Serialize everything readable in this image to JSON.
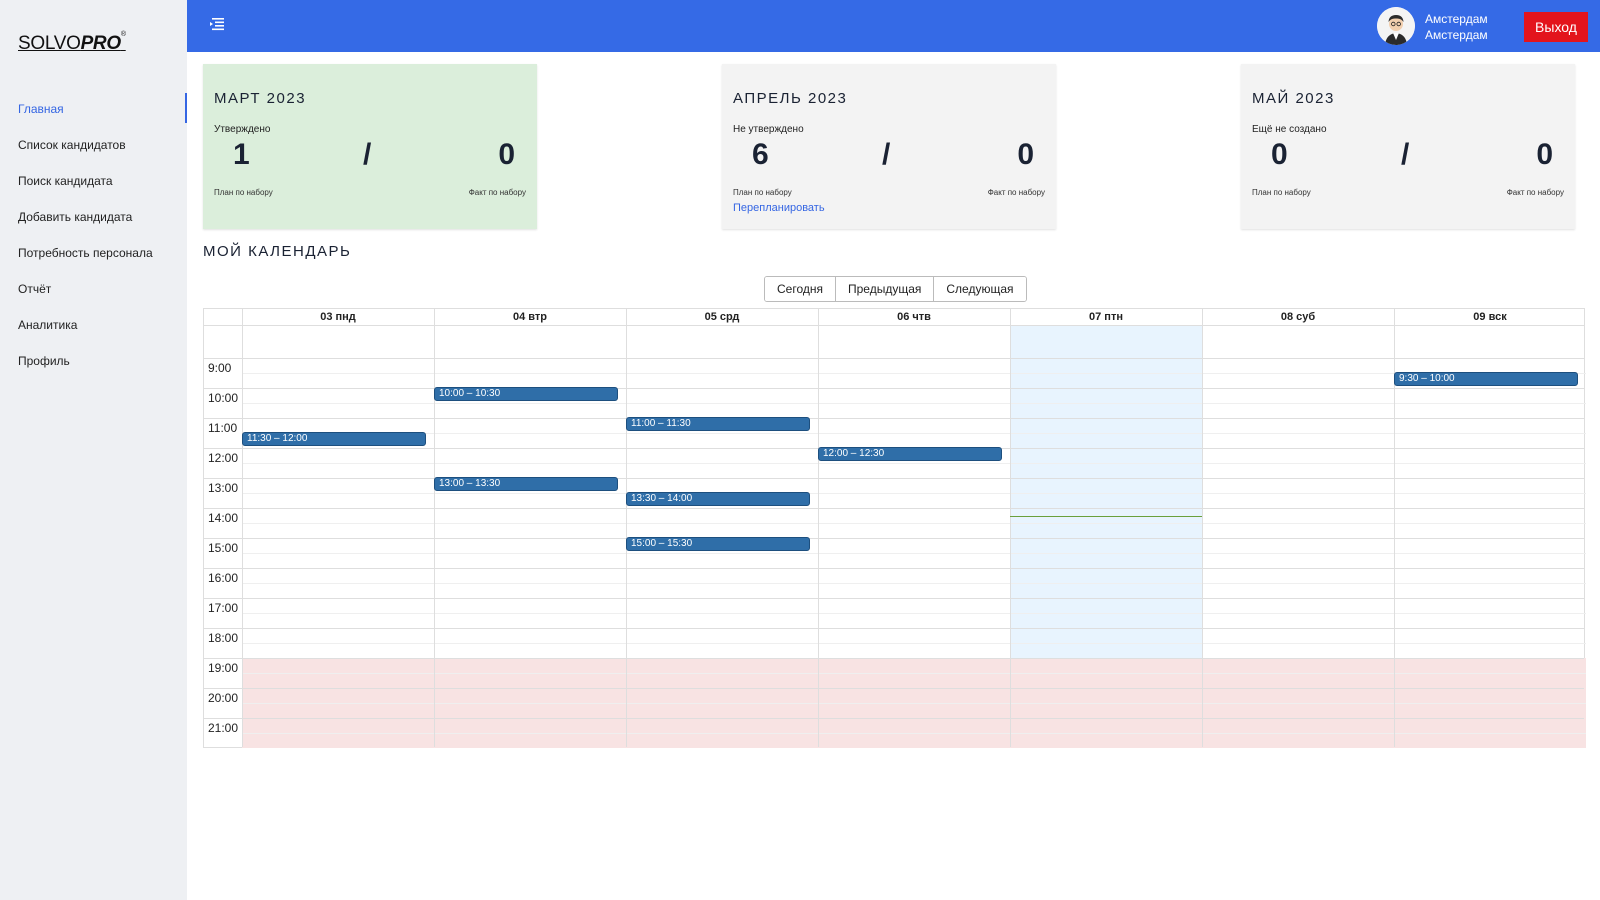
{
  "brand": {
    "name_part1": "SOLVO",
    "name_part2": "PRO",
    "mark": "®"
  },
  "sidebar": {
    "items": [
      {
        "label": "Главная",
        "active": true
      },
      {
        "label": "Список кандидатов"
      },
      {
        "label": "Поиск кандидата"
      },
      {
        "label": "Добавить кандидата"
      },
      {
        "label": "Потребность персонала"
      },
      {
        "label": "Отчёт"
      },
      {
        "label": "Аналитика"
      },
      {
        "label": "Профиль"
      }
    ]
  },
  "header": {
    "user_line1": "Амстердам",
    "user_line2": "Амстердам",
    "logout_label": "Выход",
    "accent": "#356ae6",
    "logout_color": "#e3141c"
  },
  "cards": [
    {
      "title": "МАРТ 2023",
      "status": "Утверждено",
      "plan": "1",
      "slash": "/",
      "fact": "0",
      "plan_label": "План по набору",
      "fact_label": "Факт по набору",
      "link": "",
      "color": "#dbeedb"
    },
    {
      "title": "АПРЕЛЬ 2023",
      "status": "Не утверждено",
      "plan": "6",
      "slash": "/",
      "fact": "0",
      "plan_label": "План по набору",
      "fact_label": "Факт по набору",
      "link": "Перепланировать",
      "color": "#f3f3f3"
    },
    {
      "title": "МАЙ 2023",
      "status": "Ещё не создано",
      "plan": "0",
      "slash": "/",
      "fact": "0",
      "plan_label": "План по набору",
      "fact_label": "Факт по набору",
      "link": "",
      "color": "#f3f3f3"
    }
  ],
  "calendar": {
    "title": "МОЙ КАЛЕНДАРЬ",
    "buttons": {
      "today": "Сегодня",
      "prev": "Предыдущая",
      "next": "Следующая"
    },
    "days": [
      "03 пнд",
      "04 втр",
      "05 срд",
      "06 чтв",
      "07 птн",
      "08 суб",
      "09 вск"
    ],
    "today_index": 4,
    "hours": [
      "9:00",
      "10:00",
      "11:00",
      "12:00",
      "13:00",
      "14:00",
      "15:00",
      "16:00",
      "17:00",
      "18:00",
      "19:00",
      "20:00",
      "21:00"
    ],
    "off_hours_from": "19:00",
    "now_time": "14:15",
    "event_color": "#2f6ea8",
    "events": [
      {
        "day": 0,
        "label": "11:30 – 12:00"
      },
      {
        "day": 1,
        "label": "10:00 – 10:30"
      },
      {
        "day": 1,
        "label": "13:00 – 13:30"
      },
      {
        "day": 2,
        "label": "11:00 – 11:30"
      },
      {
        "day": 2,
        "label": "13:30 – 14:00"
      },
      {
        "day": 2,
        "label": "15:00 – 15:30"
      },
      {
        "day": 3,
        "label": "12:00 – 12:30"
      },
      {
        "day": 6,
        "label": "9:30 – 10:00"
      }
    ]
  }
}
